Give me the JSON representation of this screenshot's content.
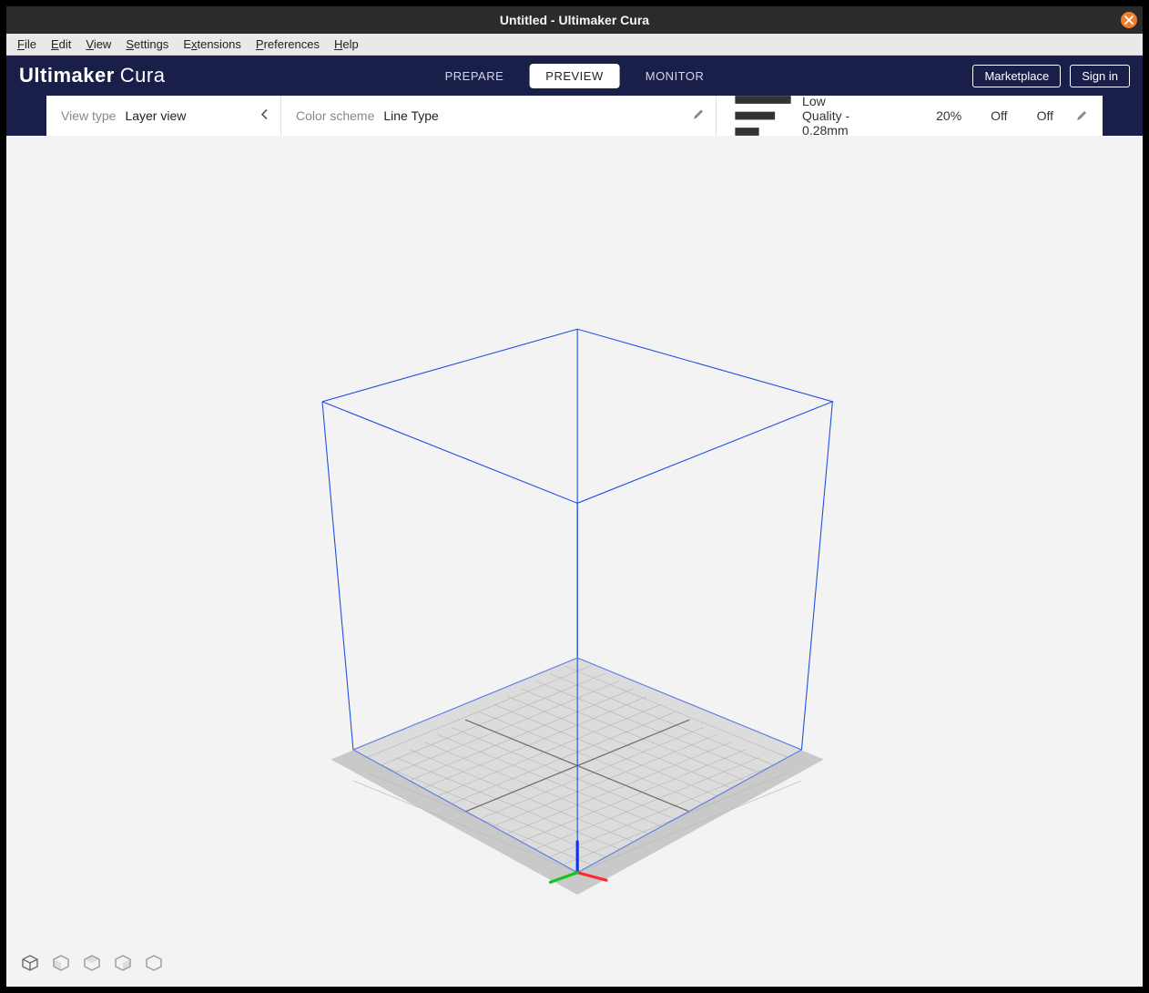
{
  "window": {
    "title": "Untitled - Ultimaker Cura"
  },
  "menu": {
    "file": "File",
    "edit": "Edit",
    "view": "View",
    "settings": "Settings",
    "extensions": "Extensions",
    "preferences": "Preferences",
    "help": "Help"
  },
  "brand": {
    "bold": "Ultimaker",
    "thin": "Cura"
  },
  "stages": {
    "prepare": "PREPARE",
    "preview": "PREVIEW",
    "monitor": "MONITOR"
  },
  "header_buttons": {
    "marketplace": "Marketplace",
    "signin": "Sign in"
  },
  "strip": {
    "viewtype_label": "View type",
    "viewtype_value": "Layer view",
    "colorscheme_label": "Color scheme",
    "colorscheme_value": "Line Type",
    "profile_text": "Low Quality - 0.28mm",
    "infill_text": "20%",
    "support_text": "Off",
    "adhesion_text": "Off"
  }
}
